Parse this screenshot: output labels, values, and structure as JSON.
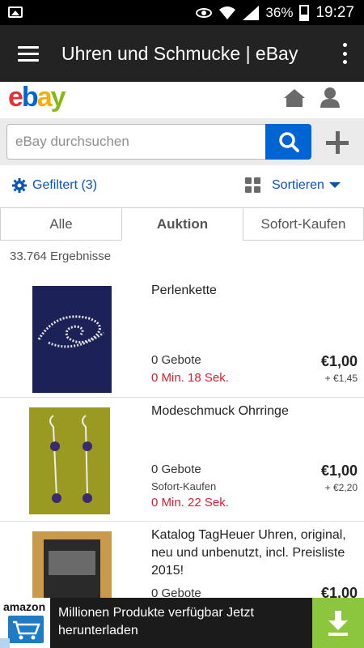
{
  "status_bar": {
    "battery": "36%",
    "time": "19:27"
  },
  "app_bar": {
    "title": "Uhren und Schmucke | eBay"
  },
  "logo": {
    "e": "e",
    "b": "b",
    "a": "a",
    "y": "y"
  },
  "search": {
    "placeholder": "eBay durchsuchen"
  },
  "filter": {
    "label": "Gefiltert (3)",
    "sort_label": "Sortieren"
  },
  "tabs": [
    {
      "label": "Alle"
    },
    {
      "label": "Auktion"
    },
    {
      "label": "Sofort-Kaufen"
    }
  ],
  "results_count": "33.764 Ergebnisse",
  "items": [
    {
      "title": "Perlenkette",
      "bids": "0 Gebote",
      "buy_it_now": "",
      "time_left": "0 Min. 18 Sek.",
      "price": "€1,00",
      "shipping": "+ €1,45"
    },
    {
      "title": "Modeschmuck Ohrringe",
      "bids": "0 Gebote",
      "buy_it_now": "Sofort-Kaufen",
      "time_left": "0 Min. 22 Sek.",
      "price": "€1,00",
      "shipping": "+ €2,20"
    },
    {
      "title": "Katalog TagHeuer Uhren, original, neu und unbenutzt, incl. Preisliste 2015!",
      "bids": "0 Gebote",
      "buy_it_now": "",
      "time_left": "",
      "price": "€1,00",
      "shipping": ""
    }
  ],
  "ad": {
    "brand": "amazon",
    "text": "Millionen Produkte verfügbar Jetzt herunterladen"
  },
  "colors": {
    "ebay_blue": "#0064d2",
    "time_red": "#dd1e31",
    "appbar": "#232323",
    "ad_green": "#8cc63f"
  }
}
